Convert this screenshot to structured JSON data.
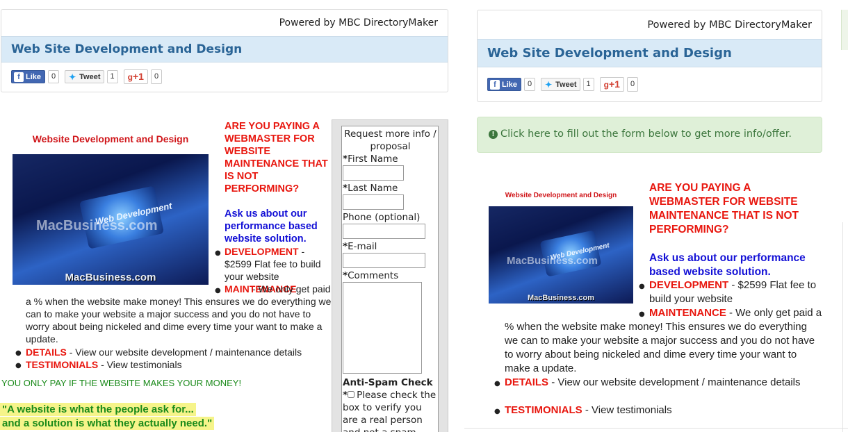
{
  "header": {
    "powered_by": "Powered by MBC DirectoryMaker",
    "title": "Web Site Development and Design"
  },
  "social": {
    "like_label": "Like",
    "like_count": "0",
    "tweet_label": "Tweet",
    "tweet_count": "1",
    "gplus_label": "+1",
    "gplus_count": "0"
  },
  "promo_image": {
    "banner": "Website Development and Design",
    "puzzle_text": "Web Development",
    "watermark": "MacBusiness.com",
    "footer": "MacBusiness.com"
  },
  "content": {
    "headline": "ARE YOU PAYING A WEBMASTER FOR WEBSITE MAINTENANCE THAT IS NOT PERFORMING?",
    "subhead": "Ask us about our performance based website solution.",
    "items": [
      {
        "key": "DEVELOPMENT",
        "text": " - $2599 Flat fee to build your website"
      },
      {
        "key": "MAINTENANCE",
        "text": " - We only get paid a % when the website make money! This ensures we do everything we can to make your website a major success and you do not have to worry about being nickeled and dime every time your want to make a update."
      },
      {
        "key": "DETAILS",
        "text": " - View our website development / maintenance details"
      },
      {
        "key": "TESTIMONIALS",
        "text": " - View testimonials"
      }
    ],
    "guarantee": "YOU ONLY PAY IF THE WEBSITE MAKES YOUR MONEY!",
    "quote_line1": "\"A website is what the people ask for...",
    "quote_line2": "and a solution is what they actually need.\""
  },
  "form": {
    "title": "Request more info / proposal",
    "required_mark": "*",
    "first_name": "First Name",
    "last_name": "Last Name",
    "phone": "Phone (optional)",
    "email": "E-mail",
    "comments": "Comments",
    "antispam_title": "Anti-Spam Check",
    "antispam_text": "Please check the box to verify you are a real person and not a spam robot"
  },
  "right_alert": "Click here to fill out the form below to get more info/offer.",
  "colors": {
    "title_blue": "#2a6496",
    "title_bar": "#d9eaf7",
    "red": "#e8170f",
    "blue": "#1310d6",
    "green_text": "#1a8a1a",
    "quote_bg": "#f6f48a",
    "alert_bg": "#dff0d8"
  }
}
